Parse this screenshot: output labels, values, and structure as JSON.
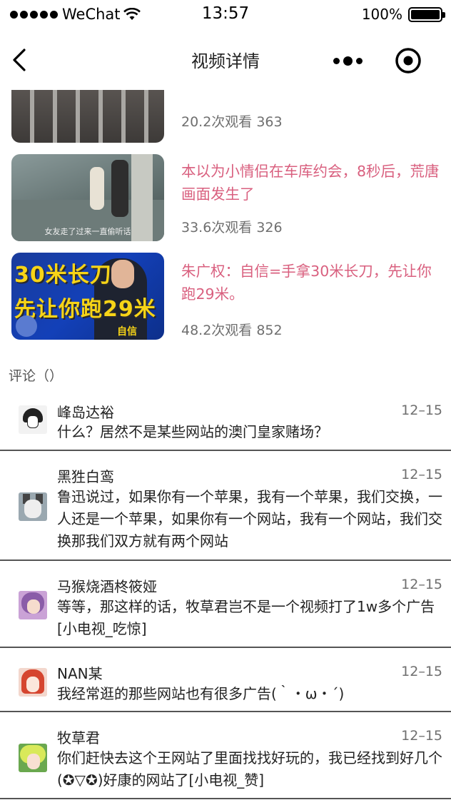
{
  "status_bar": {
    "carrier": "WeChat",
    "time": "13:57",
    "battery": "100%",
    "battery_level": 1.0
  },
  "nav": {
    "title": "视频详情",
    "back_icon": "chevron-left-icon",
    "more_icon": "more-dots-icon",
    "close_icon": "target-close-icon"
  },
  "videos": [
    {
      "title": "",
      "meta": "20.2次观看 363"
    },
    {
      "title": "本以为小情侣在车库约会，8秒后，荒唐画面发生了",
      "meta": "33.6次观看 326",
      "thumb_caption": "女友走了过来一直偷听话"
    },
    {
      "title": "朱广权：自信=手拿30米长刀，先让你跑29米。",
      "meta": "48.2次观看 852",
      "thumb_line1": "30米长刀",
      "thumb_line2": "先让你跑29米",
      "thumb_tag": "自信"
    }
  ],
  "comments_header": "评论（）",
  "comments": [
    {
      "author": "峰岛达裕",
      "date": "12–15",
      "text": "什么？居然不是某些网站的澳门皇家赌场？"
    },
    {
      "author": "黑狌白鸾",
      "date": "12–15",
      "text": "鲁迅说过，如果你有一个苹果，我有一个苹果，我们交换，一人还是一个苹果，如果你有一个网站，我有一个网站，我们交换那我们双方就有两个网站"
    },
    {
      "author": "马猴烧酒柊筱娅",
      "date": "12–15",
      "text": "等等，那这样的话，牧草君岂不是一个视频打了1w多个广告[小电视_吃惊]"
    },
    {
      "author": "NAN某",
      "date": "12–15",
      "text": "我经常逛的那些网站也有很多广告(｀・ω・´)"
    },
    {
      "author": "牧草君",
      "date": "12–15",
      "text": "你们赶快去这个王网站了里面找找好玩的，我已经找到好几个(✪▽✪)好康的网站了[小电视_赞]"
    }
  ],
  "colors": {
    "video_title": "#d9607f",
    "meta": "#6f6f6f",
    "divider": "#555555"
  }
}
